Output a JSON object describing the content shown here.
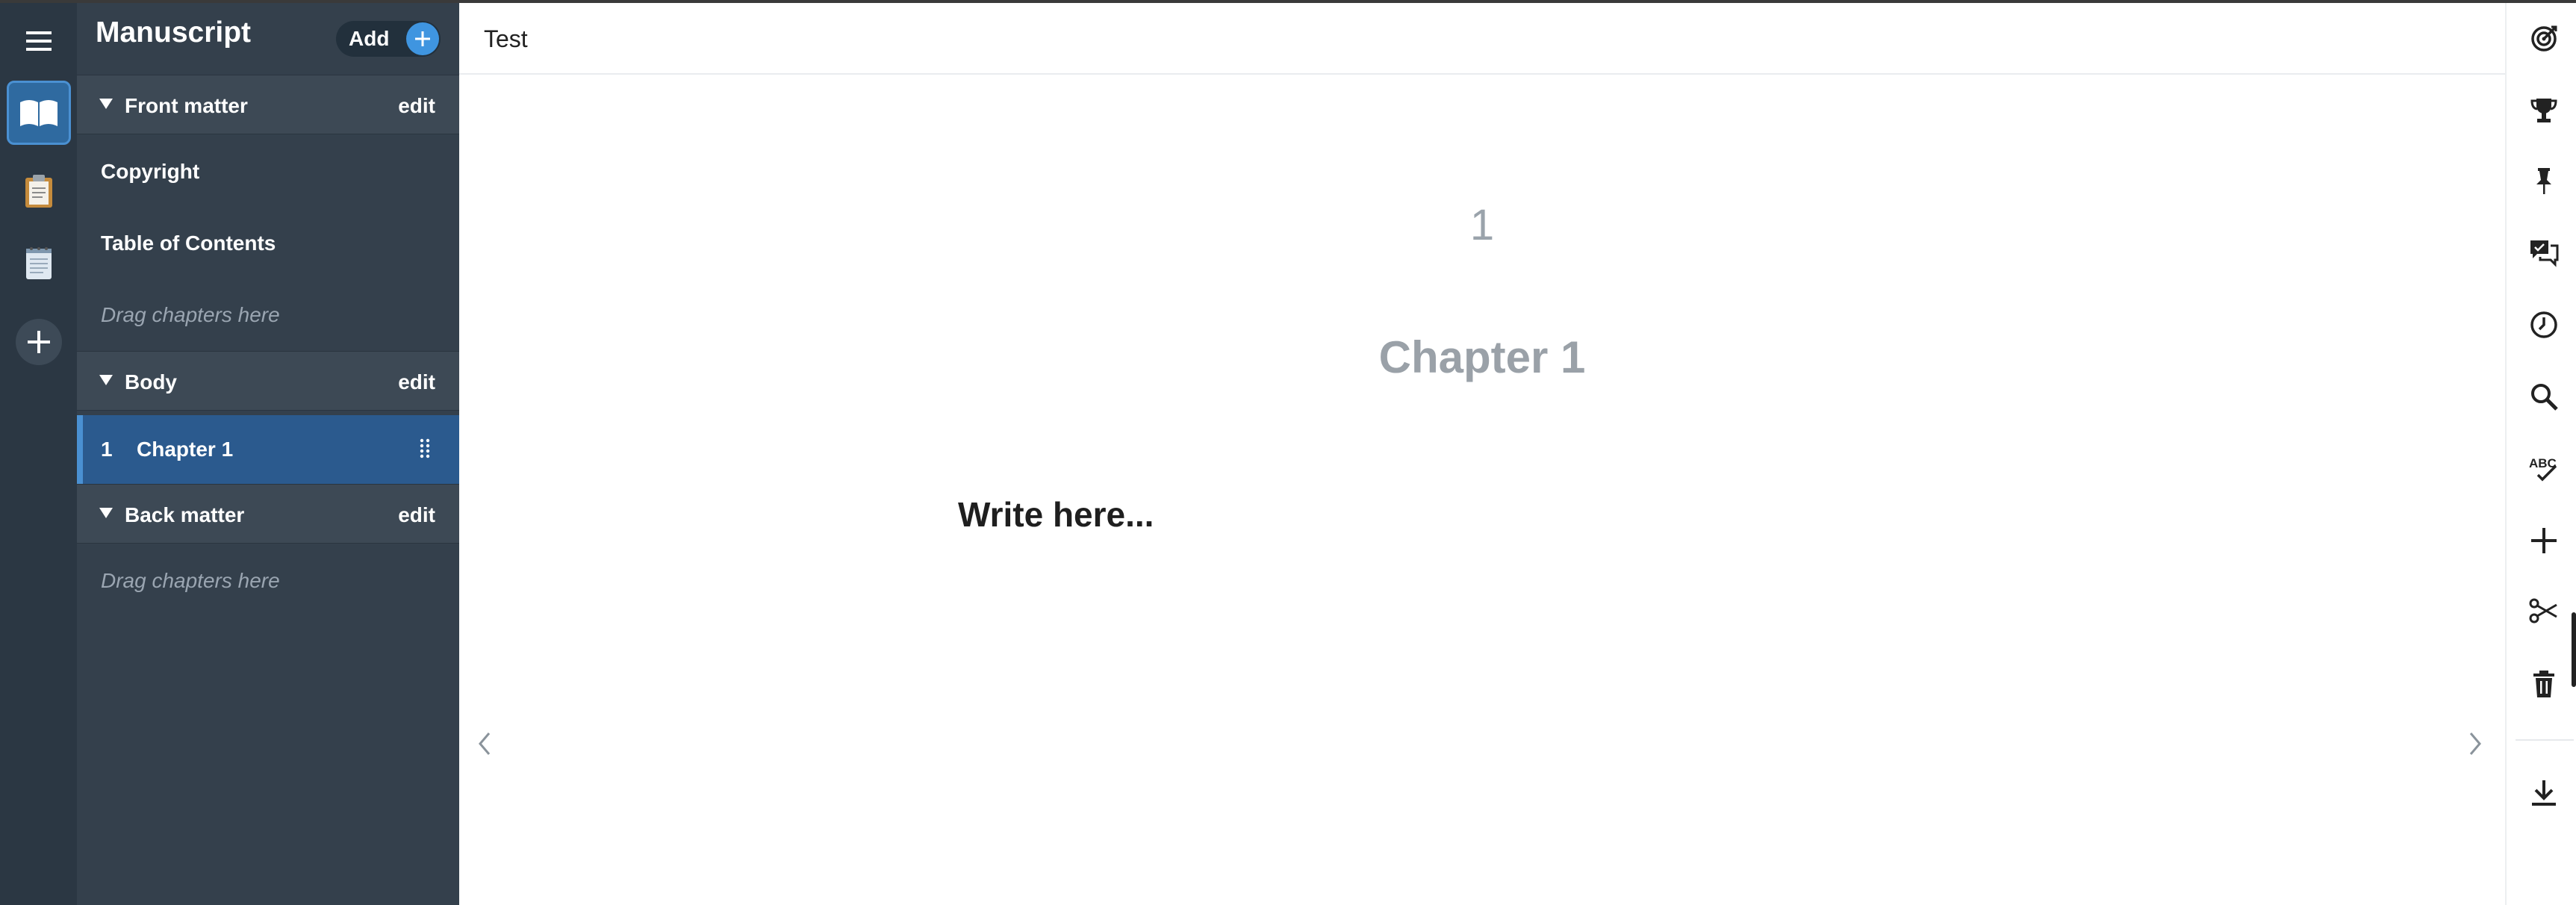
{
  "sidebar": {
    "title": "Manuscript",
    "add_label": "Add",
    "front_matter": {
      "title": "Front matter",
      "edit_label": "edit",
      "items": [
        "Copyright",
        "Table of Contents"
      ],
      "drag_hint": "Drag chapters here"
    },
    "body": {
      "title": "Body",
      "edit_label": "edit",
      "chapters": [
        {
          "number": "1",
          "name": "Chapter 1"
        }
      ]
    },
    "back_matter": {
      "title": "Back matter",
      "edit_label": "edit",
      "drag_hint": "Drag chapters here"
    }
  },
  "editor": {
    "document_title": "Test",
    "page_number": "1",
    "chapter_title": "Chapter 1",
    "placeholder": "Write here..."
  },
  "left_rail": {
    "icons": [
      "menu-icon",
      "book-open-icon",
      "clipboard-icon",
      "notepad-icon",
      "plus-icon"
    ],
    "active": "book-open-icon"
  },
  "right_toolbar": {
    "icons": [
      "goals-icon",
      "trophy-icon",
      "pin-icon",
      "comments-icon",
      "history-icon",
      "search-icon",
      "spellcheck-icon",
      "plus-icon",
      "scissors-icon",
      "trash-icon",
      "download-icon"
    ]
  },
  "colors": {
    "rail_bg": "#2b3743",
    "sidebar_bg": "#34404c",
    "section_bg": "#3d4955",
    "selected_row": "#2b5a8e",
    "accent": "#3f95e0"
  }
}
